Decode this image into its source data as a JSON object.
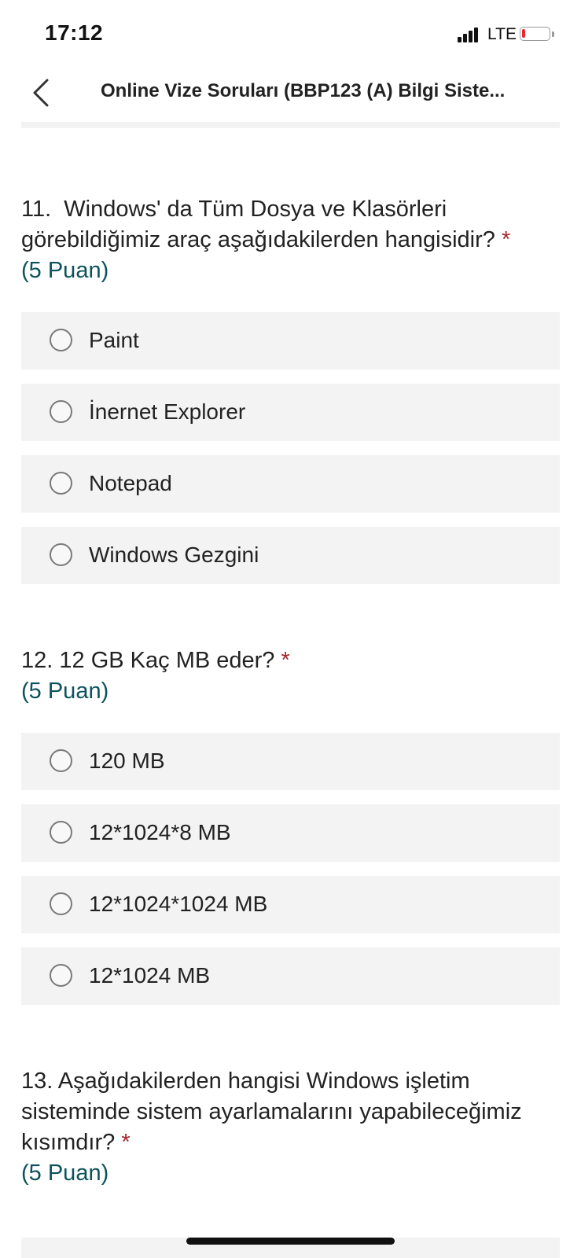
{
  "status_bar": {
    "time": "17:12",
    "network": "LTE",
    "battery_level": 0.12,
    "battery_color": "#e8262b"
  },
  "nav": {
    "title": "Online Vize Soruları (BBP123 (A) Bilgi Siste...",
    "back_icon": "chevron-left-icon"
  },
  "questions": [
    {
      "number_text": "11.",
      "text": "Windows' da Tüm Dosya ve Klasörleri görebildiğimiz araç aşağıdakilerden hangisidir?",
      "required_mark": "*",
      "points": "(5 Puan)",
      "options": [
        "Paint",
        "İnernet Explorer",
        "Notepad",
        "Windows Gezgini"
      ]
    },
    {
      "number_text": "12.",
      "text": "12 GB Kaç MB eder?",
      "required_mark": "*",
      "points": "(5 Puan)",
      "options": [
        "120 MB",
        "12*1024*8 MB",
        "12*1024*1024 MB",
        "12*1024 MB"
      ]
    },
    {
      "number_text": "13.",
      "text": "Aşağıdakilerden hangisi Windows işletim sisteminde sistem ayarlamalarını yapabileceğimiz kısımdır?",
      "required_mark": "*",
      "points": "(5 Puan)",
      "options": []
    }
  ],
  "colors": {
    "required": "#a4262c",
    "points": "#0b535c",
    "option_background": "#f3f3f3"
  }
}
